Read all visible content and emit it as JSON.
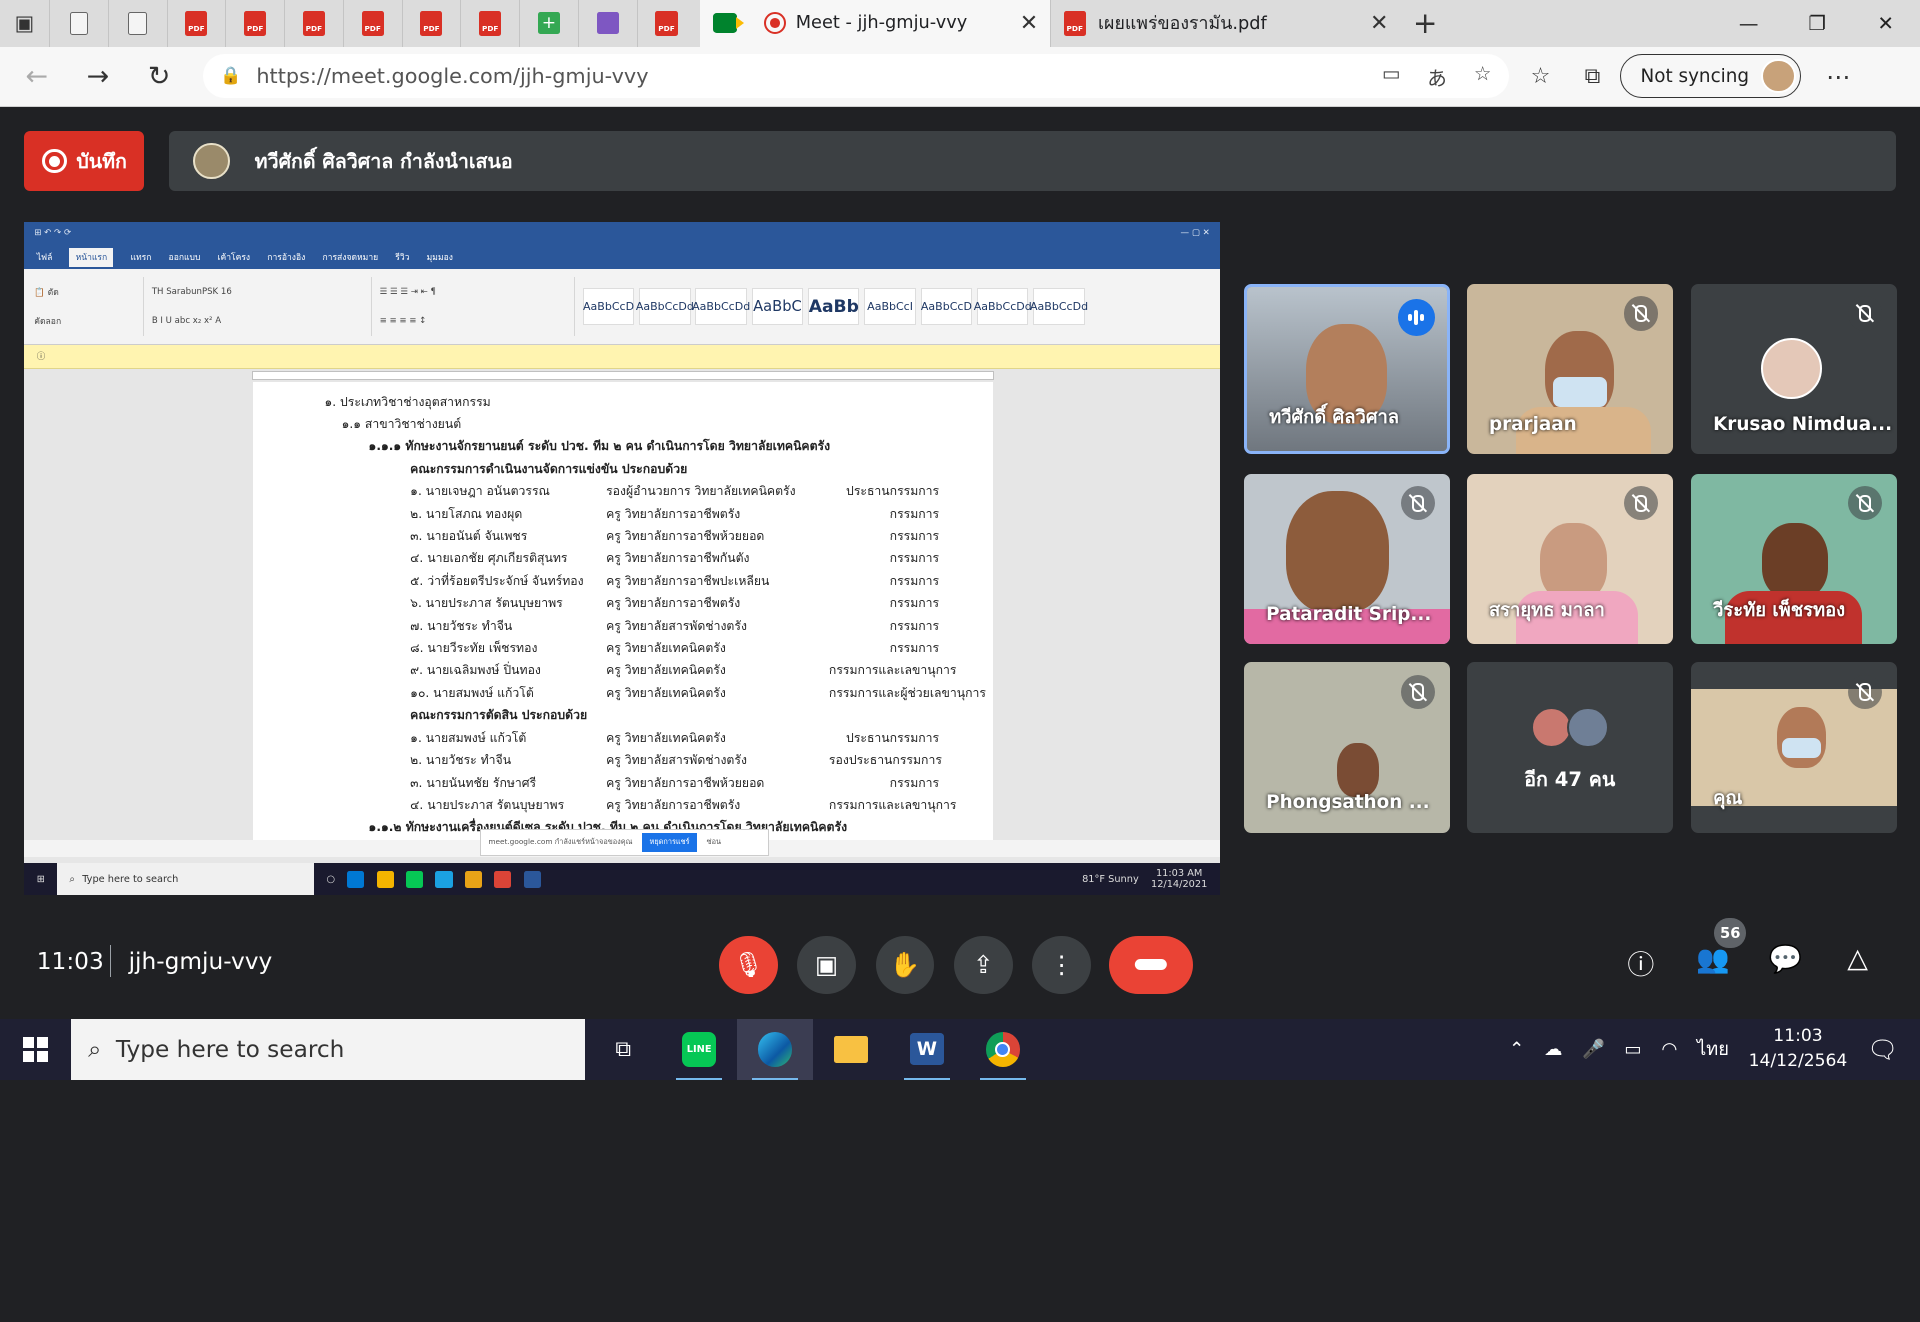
{
  "browser": {
    "active_tab_title": "Meet - jjh-gmju-vvy",
    "second_tab_title": "เผยแพร่ของรามัน.pdf",
    "url": "https://meet.google.com/jjh-gmju-vvy",
    "sync_label": "Not syncing"
  },
  "meet": {
    "record_label": "บันทึก",
    "presenting_text": "ทวีศักดิ์ ศิลวิศาล กำลังนำเสนอ",
    "time": "11:03",
    "meeting_code": "jjh-gmju-vvy",
    "participant_count": "56",
    "participants": [
      {
        "name": "ทวีศักดิ์ ศิลวิศาล",
        "speaking": true
      },
      {
        "name": "prarjaan",
        "muted": true
      },
      {
        "name": "Krusao Nimdua...",
        "muted": true
      },
      {
        "name": "Pataradit Srip...",
        "muted": true
      },
      {
        "name": "สรายุทธ มาลา",
        "muted": true
      },
      {
        "name": "วีระทัย เพ็ชรทอง",
        "muted": true
      },
      {
        "name": "Phongsathon ...",
        "muted": true
      },
      {
        "name": "อีก 47 คน"
      },
      {
        "name": "คุณ",
        "muted": true
      }
    ]
  },
  "shared_doc": {
    "heading1": "๑. ประเภทวิชาช่างอุตสาหกรรม",
    "heading2": "๑.๑ สาขาวิชาช่างยนต์",
    "heading3": "๑.๑.๑ ทักษะงานจักรยานยนต์    ระดับ ปวช. ทีม ๒ คน  ดำเนินการโดย  วิทยาลัยเทคนิคตรัง",
    "committee1": "คณะกรรมการดำเนินงานจัดการแข่งขัน  ประกอบด้วย",
    "committee2": "คณะกรรมการตัดสิน  ประกอบด้วย",
    "heading4": "๑.๑.๒ ทักษะงานเครื่องยนต์ดีเซล ระดับ ปวช. ทีม ๒ คน ดำเนินการโดย วิทยาลัยเทคนิคตรัง",
    "rows1": [
      [
        "๑. นายเจษฎา  อนันตวรรณ",
        "รองผู้อำนวยการ วิทยาลัยเทคนิคตรัง",
        "ประธานกรรมการ"
      ],
      [
        "๒. นายโสภณ  ทองผุด",
        "ครู วิทยาลัยการอาชีพตรัง",
        "กรรมการ"
      ],
      [
        "๓. นายอนันต์  จันเพชร",
        "ครู วิทยาลัยการอาชีพห้วยยอด",
        "กรรมการ"
      ],
      [
        "๔. นายเอกชัย  ศุภเกียรติสุนทร",
        "ครู วิทยาลัยการอาชีพกันตัง",
        "กรรมการ"
      ],
      [
        "๕. ว่าที่ร้อยตรีประจักษ์  จันทร์ทอง",
        "ครู วิทยาลัยการอาชีพปะเหลียน",
        "กรรมการ"
      ],
      [
        "๖. นายประภาส  รัตนบุษยาพร",
        "ครู วิทยาลัยการอาชีพตรัง",
        "กรรมการ"
      ],
      [
        "๗. นายวัชระ  ทำจีน",
        "ครู วิทยาลัยสารพัดช่างตรัง",
        "กรรมการ"
      ],
      [
        "๘. นายวีระทัย  เพ็ชรทอง",
        "ครู วิทยาลัยเทคนิคตรัง",
        "กรรมการ"
      ],
      [
        "๙. นายเฉลิมพงษ์  ปิ่นทอง",
        "ครู วิทยาลัยเทคนิคตรัง",
        "กรรมการและเลขานุการ"
      ],
      [
        "๑๐. นายสมพงษ์  แก้วโต้",
        "ครู วิทยาลัยเทคนิคตรัง",
        "กรรมการและผู้ช่วยเลขานุการ"
      ]
    ],
    "rows2": [
      [
        "๑. นายสมพงษ์  แก้วโต้",
        "ครู วิทยาลัยเทคนิคตรัง",
        "ประธานกรรมการ"
      ],
      [
        "๒. นายวัชระ  ทำจีน",
        "ครู วิทยาลัยสารพัดช่างตรัง",
        "รองประธานกรรมการ"
      ],
      [
        "๓. นายนันทชัย  รักษาศรี",
        "ครู วิทยาลัยการอาชีพห้วยยอด",
        "กรรมการ"
      ],
      [
        "๔. นายประภาส  รัตนบุษยาพร",
        "ครู วิทยาลัยการอาชีพตรัง",
        "กรรมการและเลขานุการ"
      ]
    ],
    "word_styles": [
      "AaBbCcD",
      "AaBbCcDd",
      "AaBbCcDd",
      "AaBbC",
      "AaBb",
      "AaBbCcI",
      "AaBbCcD",
      "AaBbCcDd",
      "AaBbCcDd"
    ],
    "share_popup_text": "meet.google.com กำลังแชร์หน้าจอของคุณ",
    "share_popup_stop": "หยุดการแชร์",
    "share_popup_hide": "ซ่อน",
    "remote_search": "Type here to search",
    "remote_weather": "81°F  Sunny",
    "remote_time": "11:03 AM",
    "remote_date": "12/14/2021"
  },
  "taskbar": {
    "search_placeholder": "Type here to search",
    "lang": "ไทย",
    "time": "11:03",
    "date": "14/12/2564"
  }
}
